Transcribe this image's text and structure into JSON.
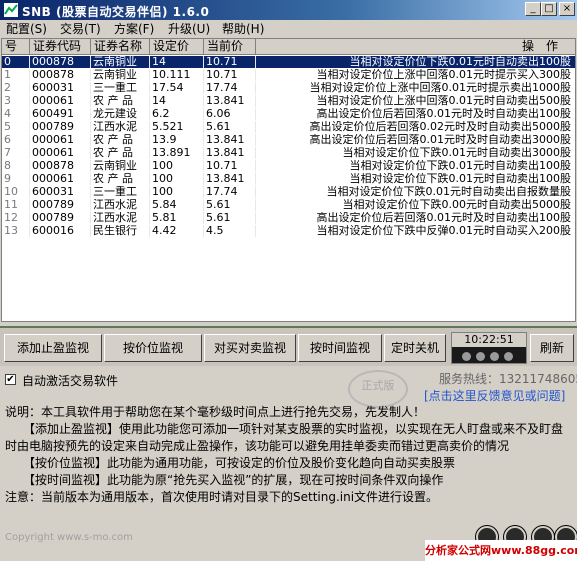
{
  "window": {
    "title": "SNB (股票自动交易伴侣) 1.6.0",
    "controls": [
      "_",
      "□",
      "×"
    ]
  },
  "menu": [
    "配置(S)",
    "交易(T)",
    "方案(F)",
    "升级(U)",
    "帮助(H)"
  ],
  "table": {
    "columns": [
      "号",
      "证券代码",
      "证券名称",
      "设定价",
      "当前价",
      "操　作"
    ],
    "selected_index": 0,
    "rows": [
      {
        "no": "0",
        "code": "000878",
        "name": "云南铜业",
        "set": "14",
        "cur": "10.71",
        "action": "当相对设定价位下跌0.01元时自动卖出100股"
      },
      {
        "no": "1",
        "code": "000878",
        "name": "云南铜业",
        "set": "10.111",
        "cur": "10.71",
        "action": "当相对设定价位上涨中回落0.01元时提示买入300股"
      },
      {
        "no": "2",
        "code": "600031",
        "name": "三一重工",
        "set": "17.54",
        "cur": "17.74",
        "action": "当相对设定价位上涨中回落0.01元时提示卖出1000股"
      },
      {
        "no": "3",
        "code": "000061",
        "name": "农 产 品",
        "set": "14",
        "cur": "13.841",
        "action": "当相对设定价位上涨中回落0.01元时自动卖出500股"
      },
      {
        "no": "4",
        "code": "600491",
        "name": "龙元建设",
        "set": "6.2",
        "cur": "6.06",
        "action": "高出设定价位后若回落0.01元时及时自动卖出100股"
      },
      {
        "no": "5",
        "code": "000789",
        "name": "江西水泥",
        "set": "5.521",
        "cur": "5.61",
        "action": "高出设定价位后若回落0.02元时及时自动卖出5000股"
      },
      {
        "no": "6",
        "code": "000061",
        "name": "农 产 品",
        "set": "13.9",
        "cur": "13.841",
        "action": "高出设定价位后若回落0.01元时及时自动卖出3000股"
      },
      {
        "no": "7",
        "code": "000061",
        "name": "农 产 品",
        "set": "13.891",
        "cur": "13.841",
        "action": "当相对设定价位下跌0.01元时自动卖出3000股"
      },
      {
        "no": "8",
        "code": "000878",
        "name": "云南铜业",
        "set": "100",
        "cur": "10.71",
        "action": "当相对设定价位下跌0.01元时自动卖出100股"
      },
      {
        "no": "9",
        "code": "000061",
        "name": "农 产 品",
        "set": "100",
        "cur": "13.841",
        "action": "当相对设定价位下跌0.01元时自动卖出100股"
      },
      {
        "no": "10",
        "code": "600031",
        "name": "三一重工",
        "set": "100",
        "cur": "17.74",
        "action": "当相对设定价位下跌0.01元时自动卖出自报数量股"
      },
      {
        "no": "11",
        "code": "000789",
        "name": "江西水泥",
        "set": "5.84",
        "cur": "5.61",
        "action": "当相对设定价位下跌0.00元时自动卖出5000股"
      },
      {
        "no": "12",
        "code": "000789",
        "name": "江西水泥",
        "set": "5.81",
        "cur": "5.61",
        "action": "高出设定价位后若回落0.01元时及时自动卖出100股"
      },
      {
        "no": "13",
        "code": "600016",
        "name": "民生银行",
        "set": "4.42",
        "cur": "4.5",
        "action": "当相对设定价位下跌中反弹0.01元时自动买入200股"
      }
    ]
  },
  "toolbar": {
    "add_stop_profit": "添加止盈监视",
    "price_monitor": "按价位监视",
    "pair_trade": "对买对卖监视",
    "time_monitor": "按时间监视",
    "timed_shutdown": "定时关机",
    "clock": "10:22:51",
    "refresh": "刷新"
  },
  "lower": {
    "auto_activate_label": "自动激活交易软件",
    "auto_activate_checked": true,
    "hotline": "服务热线：13211748605",
    "feedback_link": "[点击这里反馈意见或问题]",
    "stamp_text": "正式版",
    "description": [
      "说明：本工具软件用于帮助您在某个毫秒级时间点上进行抢先交易，先发制人！",
      "　　【添加止盈监视】使用此功能您可添加一项针对某支股票的实时监视，以实现在无人盯盘或来不及盯盘时由电脑按预先的设定来自动完成止盈操作，该功能可以避免用挂单委卖而错过更高卖价的情况",
      "　　【按价位监视】此功能为通用功能，可按设定的价位及股价变化趋向自动买卖股票",
      "　　【按时间监视】此功能为原“抢先买入监视”的扩展，现在可按时间条件双向操作",
      "注意：当前版本为通用版本，首次使用时请对目录下的Setting.ini文件进行设置。"
    ],
    "copyright": "Copyright www.s-mo.com",
    "site_badge": "分析家公式网www.88gg.com"
  },
  "colors": {
    "title_start": "#0a246a",
    "title_end": "#a6caf0",
    "selected_row": "#0a246a",
    "link": "#2255cc",
    "badge_text": "#d00000"
  }
}
